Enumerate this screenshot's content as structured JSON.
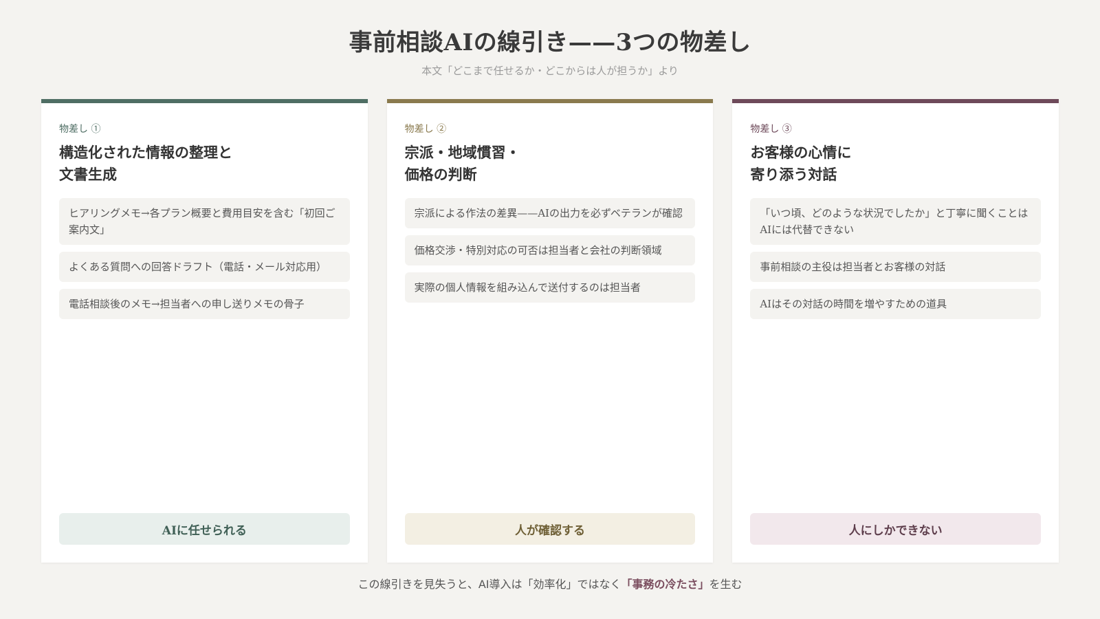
{
  "header": {
    "title": "事前相談AIの線引き——3つの物差し",
    "subtitle": "本文「どこまで任せるか・どこからは人が担うか」より"
  },
  "cards": [
    {
      "label": "物差し ①",
      "title_line1": "構造化された情報の整理と",
      "title_line2": "文書生成",
      "items": [
        "ヒアリングメモ→各プラン概要と費用目安を含む「初回ご案内文」",
        "よくある質問への回答ドラフト（電話・メール対応用）",
        "電話相談後のメモ→担当者への申し送りメモの骨子"
      ],
      "verdict": "AIに任せられる",
      "accent": "#4f6e64",
      "verdict_bg": "#e8efec",
      "verdict_fg": "#3f5f55"
    },
    {
      "label": "物差し ②",
      "title_line1": "宗派・地域慣習・",
      "title_line2": "価格の判断",
      "items": [
        "宗派による作法の差異——AIの出力を必ずベテランが確認",
        "価格交渉・特別対応の可否は担当者と会社の判断領域",
        "実際の個人情報を組み込んで送付するのは担当者"
      ],
      "verdict": "人が確認する",
      "accent": "#8a7a4e",
      "verdict_bg": "#f3efe3",
      "verdict_fg": "#6e5f35"
    },
    {
      "label": "物差し ③",
      "title_line1": "お客様の心情に",
      "title_line2": "寄り添う対話",
      "items": [
        "「いつ頃、どのような状況でしたか」と丁寧に聞くことはAIには代替できない",
        "事前相談の主役は担当者とお客様の対話",
        "AIはその対話の時間を増やすための道具"
      ],
      "verdict": "人にしかできない",
      "accent": "#6e4a5a",
      "verdict_bg": "#f2e8ec",
      "verdict_fg": "#5e3e4c"
    }
  ],
  "footer": {
    "text_before": "この線引きを見失うと、AI導入は「効率化」ではなく",
    "emphasis": "「事務の冷たさ」",
    "text_after": "を生む"
  }
}
